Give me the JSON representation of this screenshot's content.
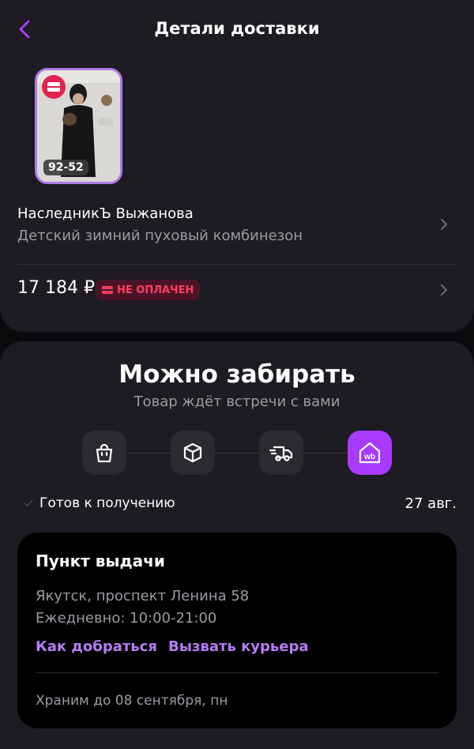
{
  "header": {
    "title": "Детали доставки"
  },
  "product": {
    "size_badge": "92-52",
    "brand": "НаследникЪ Выжанова",
    "name": "Детский зимний пуховый комбинезон",
    "price": "17 184 ₽",
    "payment_status": "НЕ ОПЛАЧЕН"
  },
  "status": {
    "title": "Можно забирать",
    "subtitle": "Товар ждёт встречи с вами",
    "steps": [
      "bag-icon",
      "box-icon",
      "truck-icon",
      "wb-pickup-icon"
    ],
    "ready_label": "Готов к получению",
    "ready_date": "27 авг."
  },
  "pickup": {
    "title": "Пункт выдачи",
    "address": "Якутск, проспект Ленина 58",
    "hours": "Ежедневно: 10:00-21:00",
    "directions_link": "Как добраться",
    "courier_link": "Вызвать курьера",
    "storage_until": "Храним до 08 сентября, пн"
  },
  "colors": {
    "accent": "#a73afd",
    "link": "#b67cf3",
    "danger": "#ff3d63",
    "card_bg": "#1e1c22"
  }
}
